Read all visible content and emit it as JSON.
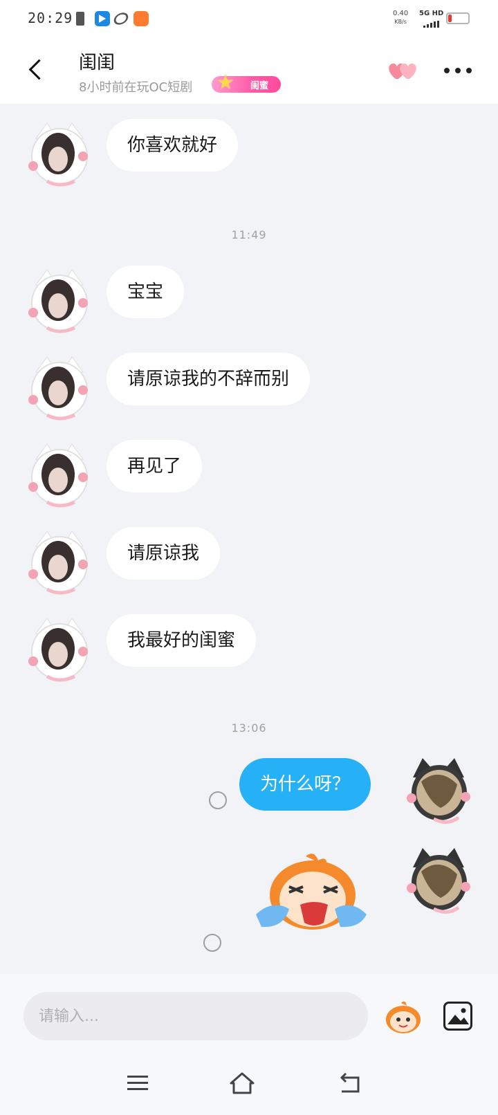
{
  "status_bar": {
    "time": "20:29",
    "net_speed_value": "0.40",
    "net_speed_unit": "KB/s",
    "network_type": "5G HD",
    "icons": [
      "battery-saver-icon",
      "blue-app-icon",
      "ring-app-icon",
      "orange-app-icon"
    ]
  },
  "header": {
    "contact_name": "闺闺",
    "last_active": "8小时前在玩OC短剧",
    "tag_label": "闺蜜",
    "back_icon": "chevron-left-icon",
    "hearts_icon": "hearts-icon",
    "more_icon": "more-dots-icon"
  },
  "messages": [
    {
      "side": "in",
      "text": "你喜欢就好"
    },
    {
      "timestamp": "11:49"
    },
    {
      "side": "in",
      "text": "宝宝"
    },
    {
      "side": "in",
      "text": "请原谅我的不辞而别"
    },
    {
      "side": "in",
      "text": "再见了"
    },
    {
      "side": "in",
      "text": "请原谅我"
    },
    {
      "side": "in",
      "text": "我最好的闺蜜"
    },
    {
      "timestamp": "13:06"
    },
    {
      "side": "out",
      "text": "为什么呀？"
    },
    {
      "side": "out",
      "sticker": "crying-mascot-sticker"
    }
  ],
  "input": {
    "placeholder": "请输入...",
    "value": ""
  },
  "colors": {
    "outgoing_bubble": "#26b0f5",
    "incoming_bubble": "#ffffff",
    "background": "#f2f3f7",
    "tag_badge": "#ff5aa5"
  },
  "nav": {
    "menu_icon": "menu-icon",
    "home_icon": "home-icon",
    "back_icon": "back-return-icon"
  }
}
